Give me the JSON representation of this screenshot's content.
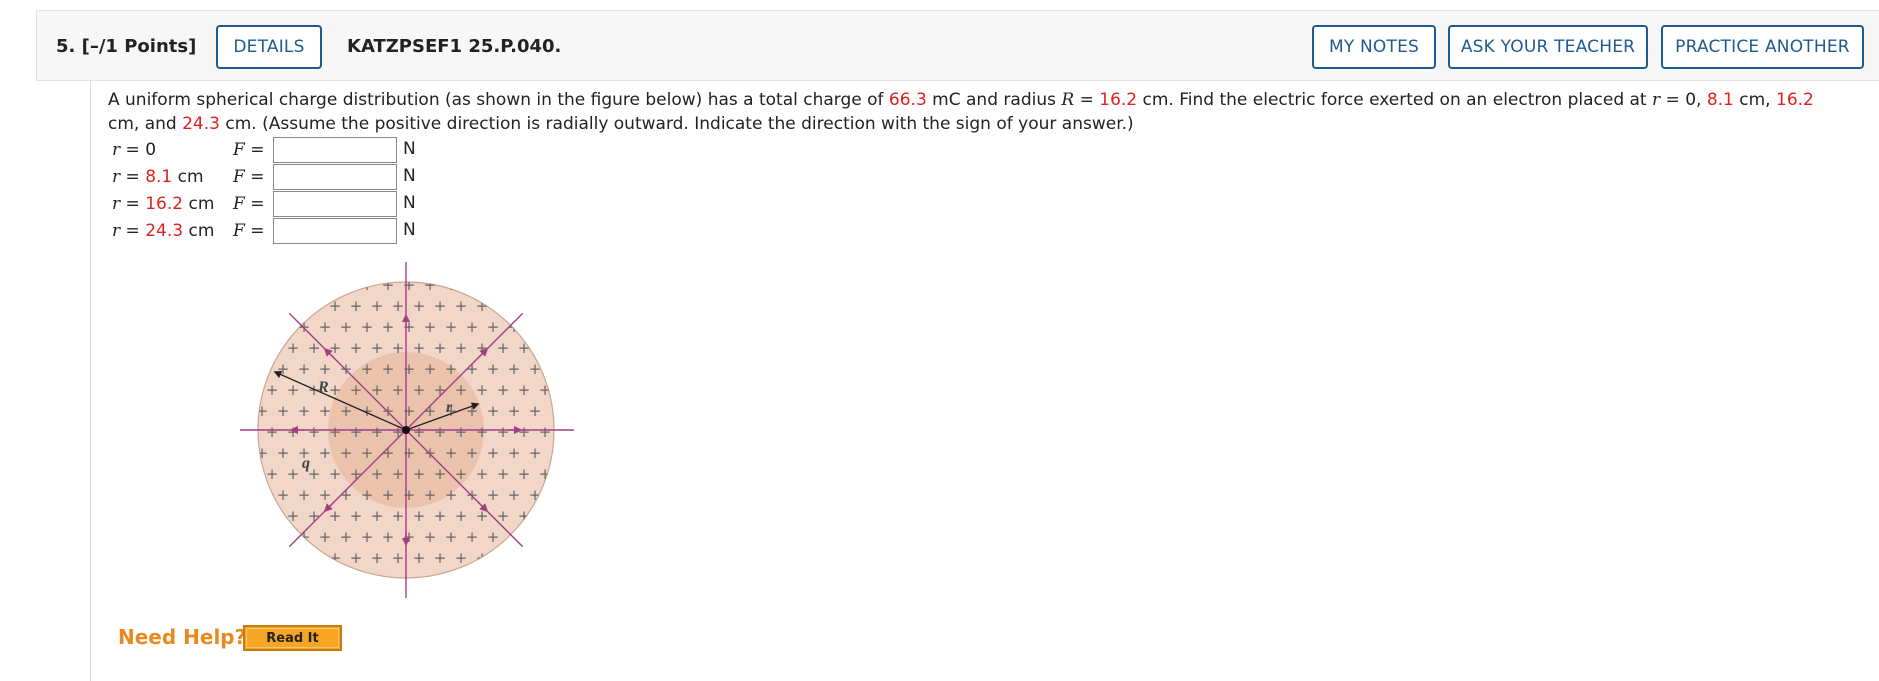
{
  "question": {
    "number_points": "5. [–/1 Points]",
    "details_label": "DETAILS",
    "id": "KATZPSEF1 25.P.040."
  },
  "toolbar": {
    "my_notes": "MY NOTES",
    "ask_teacher": "ASK YOUR TEACHER",
    "practice_another": "PRACTICE ANOTHER"
  },
  "problem": {
    "p1": "A uniform spherical charge distribution (as shown in the figure below) has a total charge of ",
    "charge": "66.3",
    "p2": " mC and radius ",
    "R_sym": "R",
    "p3": " = ",
    "radius": "16.2",
    "p4": " cm. Find the electric force exerted on an electron placed at ",
    "r_sym": "r",
    "p5": " = 0, ",
    "r2": "8.1",
    "p6": " cm, ",
    "r3": "16.2",
    "p7": " cm, and ",
    "r4": "24.3",
    "p8": " cm. (Assume the positive direction is radially outward. Indicate the direction with the sign of your answer.)"
  },
  "answers": [
    {
      "r_prefix": "r",
      "r_eq": " = 0",
      "r_value": "",
      "r_unit": "",
      "f_label": "F",
      "f_eq": " =",
      "value": "",
      "unit": "N"
    },
    {
      "r_prefix": "r",
      "r_eq": " = ",
      "r_value": "8.1",
      "r_unit": " cm",
      "f_label": "F",
      "f_eq": " =",
      "value": "",
      "unit": "N"
    },
    {
      "r_prefix": "r",
      "r_eq": " = ",
      "r_value": "16.2",
      "r_unit": " cm",
      "f_label": "F",
      "f_eq": " =",
      "value": "",
      "unit": "N"
    },
    {
      "r_prefix": "r",
      "r_eq": " = ",
      "r_value": "24.3",
      "r_unit": " cm",
      "f_label": "F",
      "f_eq": " =",
      "value": "",
      "unit": "N"
    }
  ],
  "figure": {
    "label_R": "R",
    "label_r": "r",
    "label_q": "q",
    "colors": {
      "sphere": "#f2d6c8",
      "inner": "#ebc2ab",
      "field_line": "#a23e86",
      "plus": "#666666"
    }
  },
  "help": {
    "need_help": "Need Help?",
    "read_it": "Read It"
  }
}
